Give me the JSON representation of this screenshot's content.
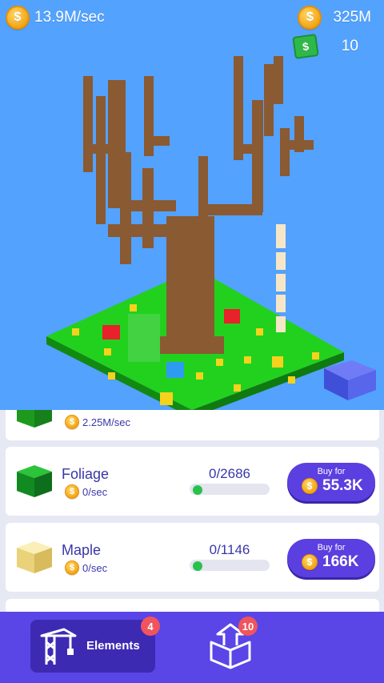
{
  "hud": {
    "income_per_sec": "13.9M/sec",
    "coins": "325M",
    "cash": "10",
    "coin_icon": "coin-icon",
    "cash_icon": "cash-icon"
  },
  "elements": [
    {
      "name": "",
      "rate": "2.25M/sec",
      "color": "#2bb02b",
      "partial": true
    },
    {
      "name": "Foliage",
      "rate": "0/sec",
      "progress_text": "0/2686",
      "progress": 0,
      "buy_label": "Buy for",
      "price": "55.3K",
      "color": "#1aa62f"
    },
    {
      "name": "Maple",
      "rate": "0/sec",
      "progress_text": "0/1146",
      "progress": 0,
      "buy_label": "Buy for",
      "price": "166K",
      "color": "#f6e08a"
    }
  ],
  "nav": {
    "elements_label": "Elements",
    "elements_badge": "4",
    "upgrade_badge": "10"
  },
  "colors": {
    "sky": "#53a2fe",
    "accent": "#5a45e6",
    "button": "#5b3fe0",
    "grass": "#25d425",
    "trunk": "#8a5a32"
  }
}
